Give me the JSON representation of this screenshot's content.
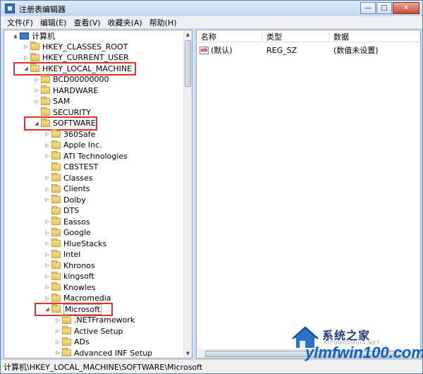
{
  "window": {
    "title": "注册表编辑器"
  },
  "menu": [
    "文件(F)",
    "编辑(E)",
    "查看(V)",
    "收藏夹(A)",
    "帮助(H)"
  ],
  "tree": [
    {
      "label": "计算机",
      "level": 0,
      "expander": "▲",
      "icon": "computer-icon"
    },
    {
      "label": "HKEY_CLASSES_ROOT",
      "level": 1,
      "expander": "▷"
    },
    {
      "label": "HKEY_CURRENT_USER",
      "level": 1,
      "expander": "▷"
    },
    {
      "label": "HKEY_LOCAL_MACHINE",
      "level": 1,
      "expander": "◢",
      "highlight": true
    },
    {
      "label": "BCD00000000",
      "level": 2,
      "expander": "▷"
    },
    {
      "label": "HARDWARE",
      "level": 2,
      "expander": "▷"
    },
    {
      "label": "SAM",
      "level": 2,
      "expander": "▷"
    },
    {
      "label": "SECURITY",
      "level": 2,
      "expander": ""
    },
    {
      "label": "SOFTWARE",
      "level": 2,
      "expander": "◢",
      "highlight": true
    },
    {
      "label": "360Safe",
      "level": 3,
      "expander": "▷"
    },
    {
      "label": "Apple Inc.",
      "level": 3,
      "expander": "▷"
    },
    {
      "label": "ATI Technologies",
      "level": 3,
      "expander": "▷"
    },
    {
      "label": "CBSTEST",
      "level": 3,
      "expander": ""
    },
    {
      "label": "Classes",
      "level": 3,
      "expander": "▷"
    },
    {
      "label": "Clients",
      "level": 3,
      "expander": "▷"
    },
    {
      "label": "Dolby",
      "level": 3,
      "expander": "▷"
    },
    {
      "label": "DTS",
      "level": 3,
      "expander": ""
    },
    {
      "label": "Eassos",
      "level": 3,
      "expander": "▷"
    },
    {
      "label": "Google",
      "level": 3,
      "expander": "▷"
    },
    {
      "label": "HlueStacks",
      "level": 3,
      "expander": "▷"
    },
    {
      "label": "Intel",
      "level": 3,
      "expander": "▷"
    },
    {
      "label": "Khronos",
      "level": 3,
      "expander": "▷"
    },
    {
      "label": "kingsoft",
      "level": 3,
      "expander": "▷"
    },
    {
      "label": "Knowles",
      "level": 3,
      "expander": "▷"
    },
    {
      "label": "Macromedia",
      "level": 3,
      "expander": "▷"
    },
    {
      "label": "Microsoft",
      "level": 3,
      "expander": "◢",
      "highlight": true,
      "selected": true
    },
    {
      "label": ".NETFramework",
      "level": 4,
      "expander": "▷"
    },
    {
      "label": "Active Setup",
      "level": 4,
      "expander": "▷"
    },
    {
      "label": "ADs",
      "level": 4,
      "expander": "▷"
    },
    {
      "label": "Advanced INF Setup",
      "level": 4,
      "expander": "▷"
    }
  ],
  "values_pane": {
    "columns": [
      "名称",
      "类型",
      "数据"
    ],
    "rows": [
      {
        "name": "(默认)",
        "type": "REG_SZ",
        "data": "(数值未设置)",
        "icon": "string-value-icon"
      }
    ]
  },
  "status": "计算机\\HKEY_LOCAL_MACHINE\\SOFTWARE\\Microsoft",
  "watermark": {
    "cn": "系统之家",
    "sub": "XITONGZHIJIA.NET",
    "site": "ylmfwin100.com"
  },
  "colors": {
    "highlight": "#e03131",
    "folder": "#e8c15b",
    "titlebar": "#c4d8f0",
    "watermark": "#0b62c4"
  }
}
